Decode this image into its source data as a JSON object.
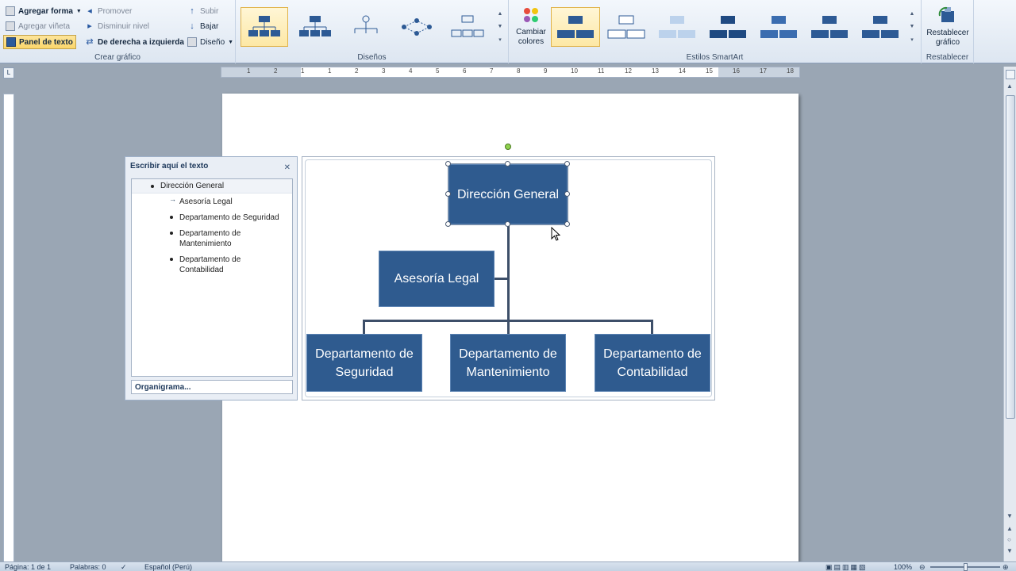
{
  "ribbon": {
    "crear_grafico": {
      "label": "Crear gráfico",
      "agregar_forma": "Agregar forma",
      "agregar_vineta": "Agregar viñeta",
      "panel_texto": "Panel de texto",
      "promover": "Promover",
      "disminuir_nivel": "Disminuir nivel",
      "derecha_izquierda": "De derecha a izquierda",
      "subir": "Subir",
      "bajar": "Bajar",
      "diseno": "Diseño"
    },
    "disenos": {
      "label": "Diseños"
    },
    "cambiar_colores": "Cambiar colores",
    "estilos": {
      "label": "Estilos SmartArt"
    },
    "restablecer": {
      "label": "Restablecer",
      "button": "Restablecer gráfico"
    }
  },
  "ruler": {
    "numbers": [
      "1",
      "2",
      "1",
      "1",
      "2",
      "3",
      "4",
      "5",
      "6",
      "7",
      "8",
      "9",
      "10",
      "11",
      "12",
      "13",
      "14",
      "15",
      "16",
      "17",
      "18"
    ]
  },
  "text_pane": {
    "title": "Escribir aquí el texto",
    "items": [
      "Dirección General",
      "Asesoría Legal",
      "Departamento de Seguridad",
      "Departamento de Mantenimiento",
      "Departamento de Contabilidad"
    ],
    "footer": "Organigrama..."
  },
  "diagram": {
    "top": "Dirección General",
    "assistant": "Asesoría Legal",
    "children": [
      "Departamento de Seguridad",
      "Departamento de Mantenimiento",
      "Departamento de Contabilidad"
    ]
  },
  "status": {
    "pagina": "Página: 1 de 1",
    "palabras": "Palabras: 0",
    "idioma": "Español (Perú)",
    "zoom": "100%"
  }
}
